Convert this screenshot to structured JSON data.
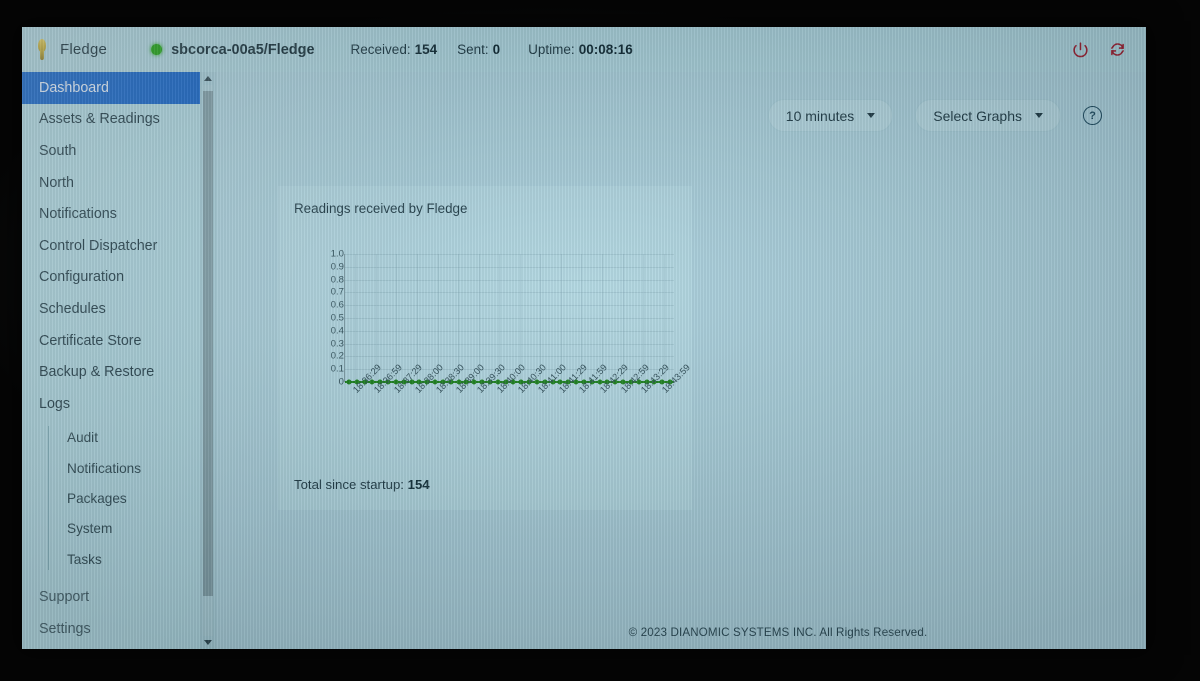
{
  "header": {
    "brand": "Fledge",
    "brand_icon": "fledge-bird-logo",
    "status_icon": "status-dot-online",
    "node": "sbcorca-00a5/Fledge",
    "stats": [
      {
        "label": "Received:",
        "value": "154"
      },
      {
        "label": "Sent:",
        "value": "0"
      },
      {
        "label": "Uptime:",
        "value": "00:08:16"
      }
    ],
    "power_icon": "power-icon",
    "refresh_icon": "refresh-icon",
    "icon_color": "#9c2437"
  },
  "sidebar": {
    "active": "Dashboard",
    "items": [
      {
        "label": "Dashboard"
      },
      {
        "label": "Assets & Readings"
      },
      {
        "label": "South"
      },
      {
        "label": "North"
      },
      {
        "label": "Notifications"
      },
      {
        "label": "Control Dispatcher"
      },
      {
        "label": "Configuration"
      },
      {
        "label": "Schedules"
      },
      {
        "label": "Certificate Store"
      },
      {
        "label": "Backup & Restore"
      },
      {
        "label": "Logs"
      }
    ],
    "log_subitems": [
      {
        "label": "Audit"
      },
      {
        "label": "Notifications"
      },
      {
        "label": "Packages"
      },
      {
        "label": "System"
      },
      {
        "label": "Tasks"
      }
    ],
    "footer_items": [
      {
        "label": "Support"
      },
      {
        "label": "Settings"
      }
    ],
    "active_bg": "#1566c8"
  },
  "toolbar": {
    "time_range": "10 minutes",
    "select_graphs": "Select Graphs",
    "help_glyph": "?"
  },
  "card": {
    "title": "Readings received by Fledge",
    "total_label": "Total since startup:",
    "total_value": "154"
  },
  "footer": {
    "copyright": "© 2023 DIANOMIC SYSTEMS INC. All Rights Reserved."
  },
  "chart_data": {
    "type": "line",
    "title": "Readings received by Fledge",
    "xlabel": "",
    "ylabel": "",
    "ylim": [
      0,
      1.0
    ],
    "grid": true,
    "legend": "none",
    "series_color": "#17801b",
    "yticks": [
      "1.0",
      "0.9",
      "0.8",
      "0.7",
      "0.6",
      "0.5",
      "0.4",
      "0.3",
      "0.2",
      "0.1",
      "0"
    ],
    "x": [
      "18:36:29",
      "18:36:59",
      "18:37:29",
      "18:38:00",
      "18:38:30",
      "18:39:00",
      "18:39:30",
      "18:40:00",
      "18:40:30",
      "18:41:00",
      "18:41:29",
      "18:41:59",
      "18:42:29",
      "18:42:59",
      "18:43:29",
      "18:43:59"
    ],
    "xtick_labels": [
      "18:36:29",
      "18:36:59",
      "18:37:29",
      "18:38:00",
      "18:38:30",
      "18:39:00",
      "18:39:30",
      "18:40:00",
      "18:40:30",
      "18:41:00",
      "18:41:29",
      "18:41:59",
      "18:42:29",
      "18:42:59",
      "18:43:29",
      "18:43:59"
    ],
    "point_count": 42,
    "series": [
      {
        "name": "Readings received by Fledge",
        "values": [
          0,
          0,
          0,
          0,
          0,
          0,
          0,
          0,
          0,
          0,
          0,
          0,
          0,
          0,
          0,
          0,
          0,
          0,
          0,
          0,
          0,
          0,
          0,
          0,
          0,
          0,
          0,
          0,
          0,
          0,
          0,
          0,
          0,
          0,
          0,
          0,
          0,
          0,
          0,
          0,
          0,
          0
        ]
      }
    ]
  }
}
